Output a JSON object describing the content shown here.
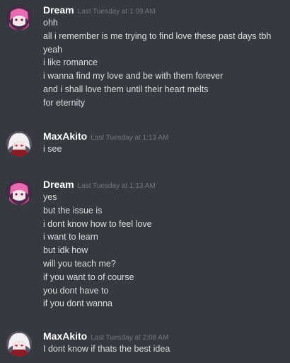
{
  "messages": [
    {
      "author": "Dream",
      "timestamp": "Last Tuesday at 1:09 AM",
      "avatar": "dream-avatar",
      "lines": [
        "ohh",
        "all i remember is me trying to find love these past days tbh",
        "yeah",
        "i like romance",
        "i wanna find my love and be with them forever",
        "and i shall love them until their heart melts",
        "for eternity"
      ]
    },
    {
      "author": "MaxAkito",
      "timestamp": "Last Tuesday at 1:13 AM",
      "avatar": "maxakito-avatar",
      "lines": [
        "i see"
      ]
    },
    {
      "author": "Dream",
      "timestamp": "Last Tuesday at 1:13 AM",
      "avatar": "dream-avatar",
      "lines": [
        "yes",
        "but the issue is",
        "i dont know how to feel love",
        "i want to learn",
        "but idk how",
        "will you teach me?",
        "if you want to of course",
        "you dont have to",
        "if you dont wanna"
      ]
    },
    {
      "author": "MaxAkito",
      "timestamp": "Last Tuesday at 2:08 AM",
      "avatar": "maxakito-avatar",
      "lines": [
        "I dont know if thats the best idea"
      ]
    }
  ],
  "colors": {
    "background": "#36393f",
    "username": "#ffffff",
    "timestamp": "#72767d",
    "text": "#dcddde"
  }
}
